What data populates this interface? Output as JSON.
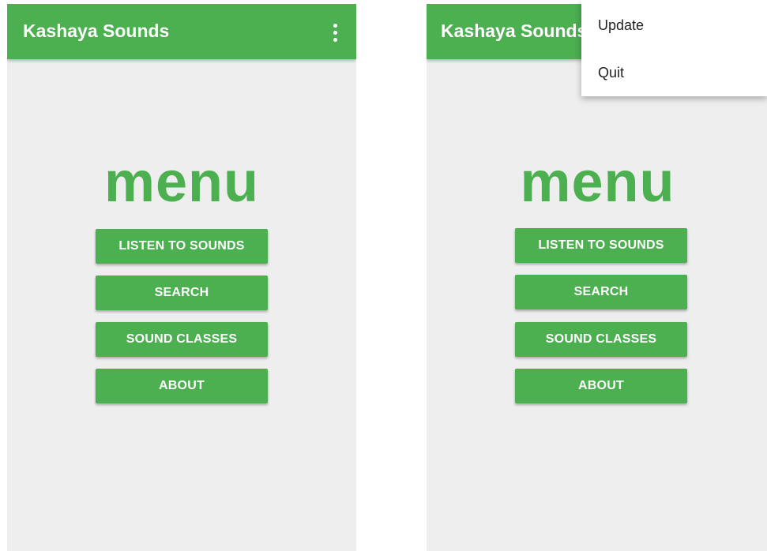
{
  "colors": {
    "accent": "#4caf50",
    "background": "#eeeeee",
    "text_on_accent": "#ffffff"
  },
  "screens": [
    {
      "appbar": {
        "title": "Kashaya Sounds",
        "overflow_icon": "more-vert-icon"
      },
      "heading": "menu",
      "buttons": [
        {
          "label": "LISTEN TO SOUNDS"
        },
        {
          "label": "SEARCH"
        },
        {
          "label": "SOUND CLASSES"
        },
        {
          "label": "ABOUT"
        }
      ]
    },
    {
      "appbar": {
        "title": "Kashaya Sounds"
      },
      "heading": "menu",
      "buttons": [
        {
          "label": "LISTEN TO SOUNDS"
        },
        {
          "label": "SEARCH"
        },
        {
          "label": "SOUND CLASSES"
        },
        {
          "label": "ABOUT"
        }
      ],
      "overflow_menu": {
        "items": [
          {
            "label": "Update"
          },
          {
            "label": "Quit"
          }
        ]
      }
    }
  ]
}
